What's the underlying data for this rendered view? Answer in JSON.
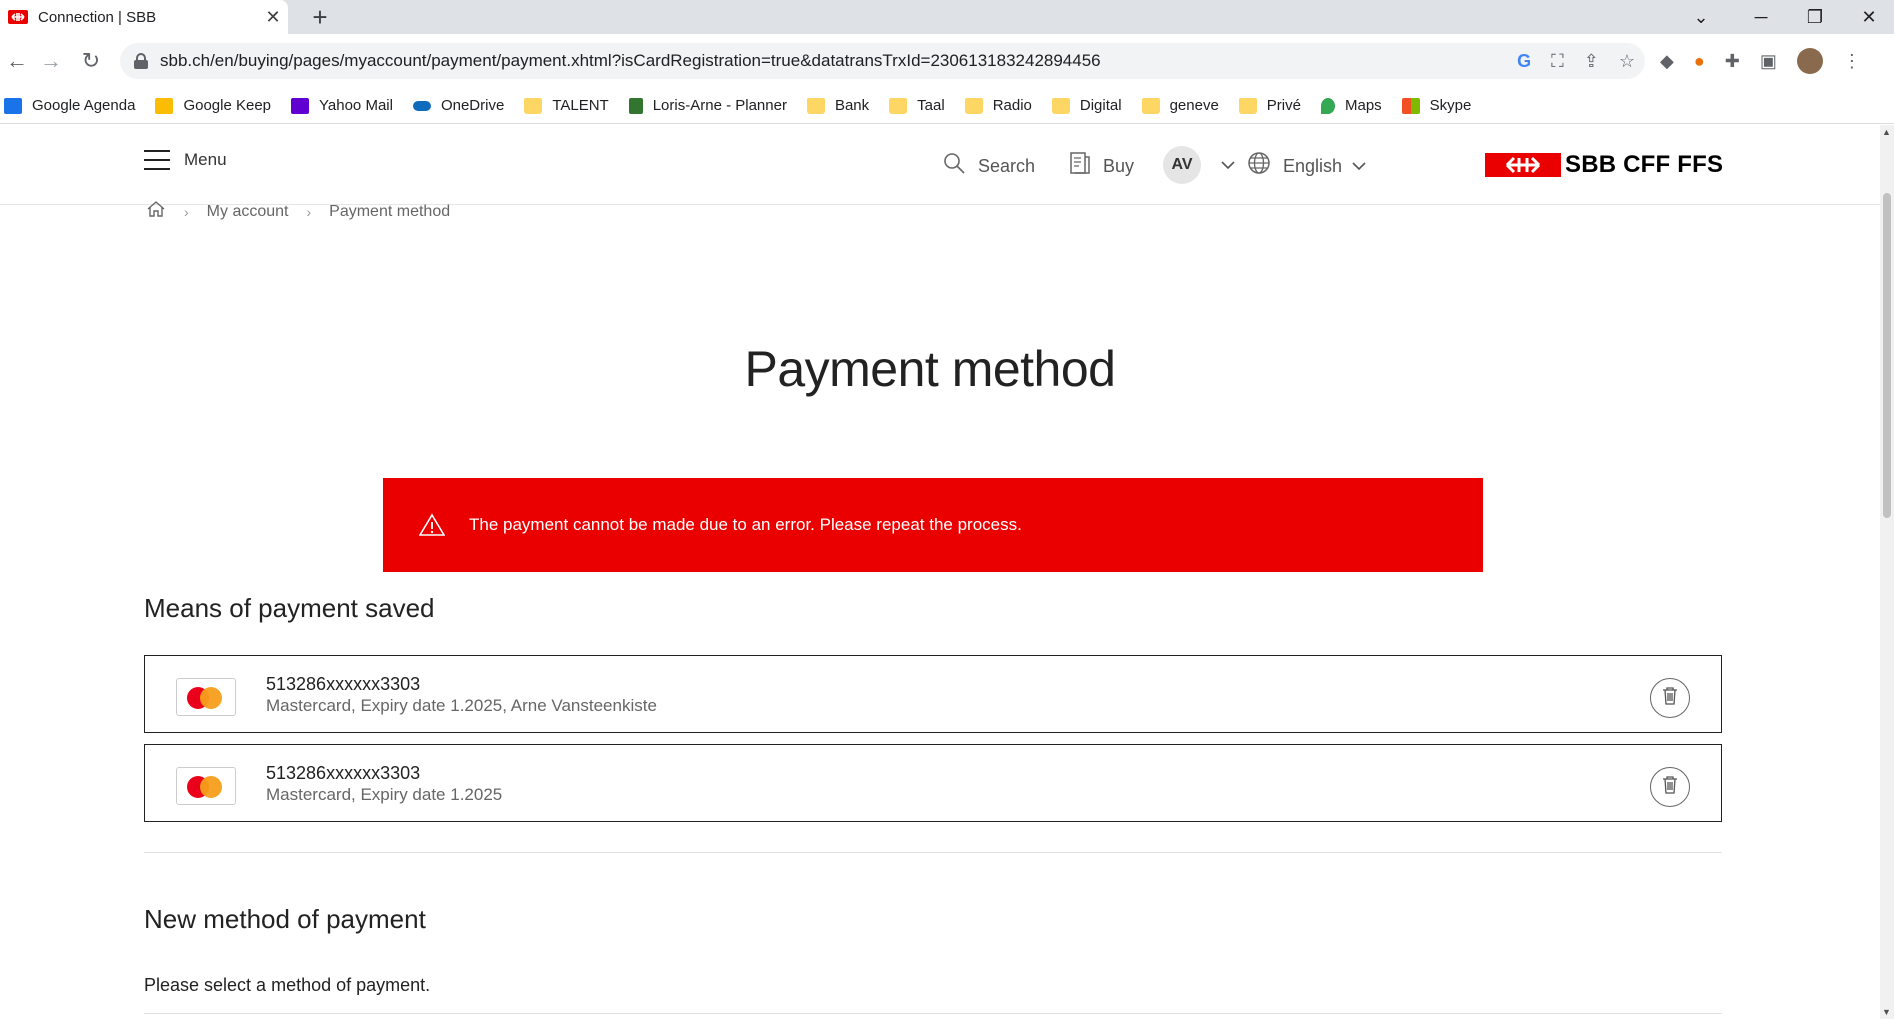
{
  "browser": {
    "tab_title": "Connection | SBB",
    "url": "sbb.ch/en/buying/pages/myaccount/payment/payment.xhtml?isCardRegistration=true&datatransTrxId=230613183242894456",
    "bookmarks": [
      {
        "label": "Google Agenda",
        "icon": "calendar-icon",
        "color": "#1a73e8"
      },
      {
        "label": "Google Keep",
        "icon": "keep-icon",
        "color": "#fbbc04"
      },
      {
        "label": "Yahoo Mail",
        "icon": "mail-icon",
        "color": "#6001d2"
      },
      {
        "label": "OneDrive",
        "icon": "cloud-icon",
        "color": "#0f6cbd"
      },
      {
        "label": "TALENT",
        "icon": "folder-icon",
        "color": "#fdd663"
      },
      {
        "label": "Loris-Arne - Planner",
        "icon": "planner-icon",
        "color": "#31752f"
      },
      {
        "label": "Bank",
        "icon": "folder-icon",
        "color": "#fdd663"
      },
      {
        "label": "Taal",
        "icon": "folder-icon",
        "color": "#fdd663"
      },
      {
        "label": "Radio",
        "icon": "folder-icon",
        "color": "#fdd663"
      },
      {
        "label": "Digital",
        "icon": "folder-icon",
        "color": "#fdd663"
      },
      {
        "label": "geneve",
        "icon": "folder-icon",
        "color": "#fdd663"
      },
      {
        "label": "Privé",
        "icon": "folder-icon",
        "color": "#fdd663"
      },
      {
        "label": "Maps",
        "icon": "map-pin-icon",
        "color": "#34a853"
      },
      {
        "label": "Skype",
        "icon": "windows-icon",
        "color": "#f25022"
      }
    ]
  },
  "header": {
    "menu_label": "Menu",
    "search_label": "Search",
    "buy_label": "Buy",
    "user_initials": "AV",
    "language_label": "English",
    "logo_text": "SBB CFF FFS",
    "brand_color": "#eb0000"
  },
  "breadcrumb": {
    "items": [
      "My account",
      "Payment method"
    ]
  },
  "main": {
    "title": "Payment method",
    "error_message": "The payment cannot be made due to an error. Please repeat the process.",
    "saved_title": "Means of payment saved",
    "cards": [
      {
        "number": "513286xxxxxx3303",
        "details": "Mastercard, Expiry date 1.2025, Arne Vansteenkiste"
      },
      {
        "number": "513286xxxxxx3303",
        "details": "Mastercard, Expiry date 1.2025"
      }
    ],
    "new_title": "New method of payment",
    "select_prompt": "Please select a method of payment."
  }
}
